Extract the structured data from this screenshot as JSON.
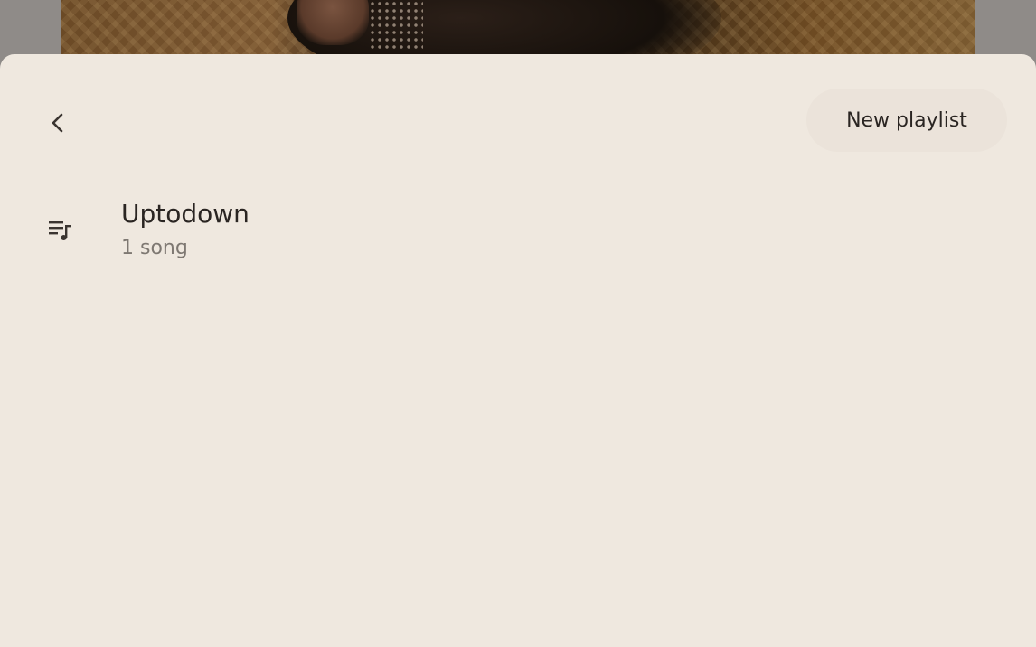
{
  "header": {
    "back_icon": "chevron-left-icon",
    "new_playlist_label": "New playlist"
  },
  "playlists": [
    {
      "icon": "playlist-music-icon",
      "title": "Uptodown",
      "subtitle": "1 song"
    }
  ],
  "colors": {
    "sheet_background": "#efe8df",
    "button_background": "#ebe3da",
    "primary_text": "#2a2522",
    "secondary_text": "#7e7872"
  }
}
